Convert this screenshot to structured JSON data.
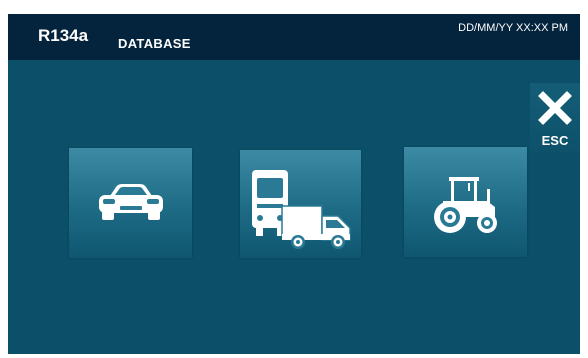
{
  "header": {
    "refrigerant": "R134a",
    "section": "DATABASE",
    "datetime": "DD/MM/YY XX:XX PM"
  },
  "esc_button": {
    "label": "ESC",
    "icon": "close-x-icon"
  },
  "vehicle_categories": [
    {
      "id": "car",
      "icon": "car-icon"
    },
    {
      "id": "bus-truck",
      "icon": "bus-truck-icon"
    },
    {
      "id": "tractor",
      "icon": "tractor-icon"
    }
  ],
  "colors": {
    "background": "#0b5068",
    "header": "#04243d",
    "tile_top": "#3c8aa4",
    "tile_bottom": "#0f5670",
    "icon": "#ffffff"
  }
}
